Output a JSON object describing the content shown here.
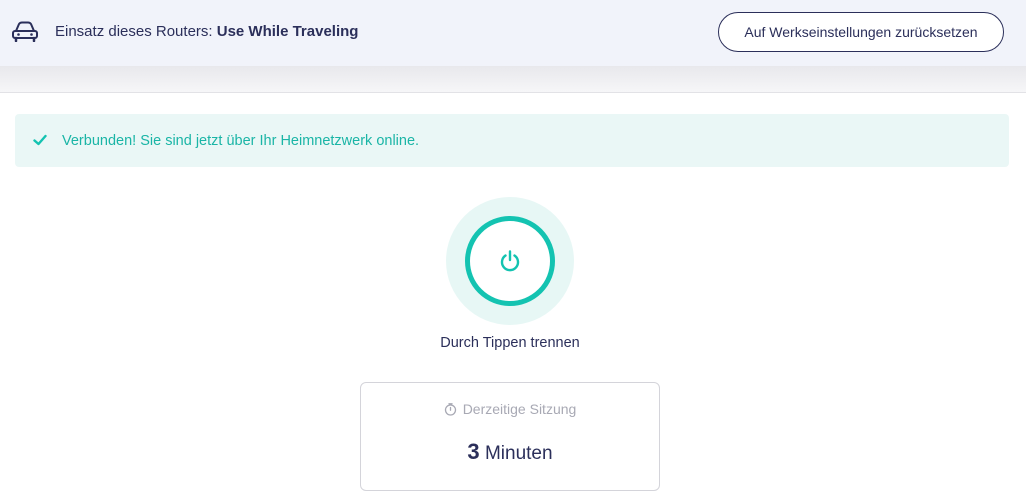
{
  "header": {
    "usage_prefix": "Einsatz dieses Routers:",
    "usage_value": "Use While Traveling",
    "reset_button_label": "Auf Werkseinstellungen zurücksetzen",
    "car_icon": "car-icon"
  },
  "alert": {
    "icon": "check-icon",
    "text": "Verbunden! Sie sind jetzt über Ihr Heimnetzwerk online."
  },
  "connection": {
    "power_icon": "power-icon",
    "action_label": "Durch Tippen trennen"
  },
  "session": {
    "icon": "timer-icon",
    "title": "Derzeitige Sitzung",
    "value": "3",
    "unit": "Minuten"
  },
  "colors": {
    "accent": "#14c3b1",
    "text_primary": "#2b2f5a",
    "alert_bg": "#eaf7f6"
  }
}
